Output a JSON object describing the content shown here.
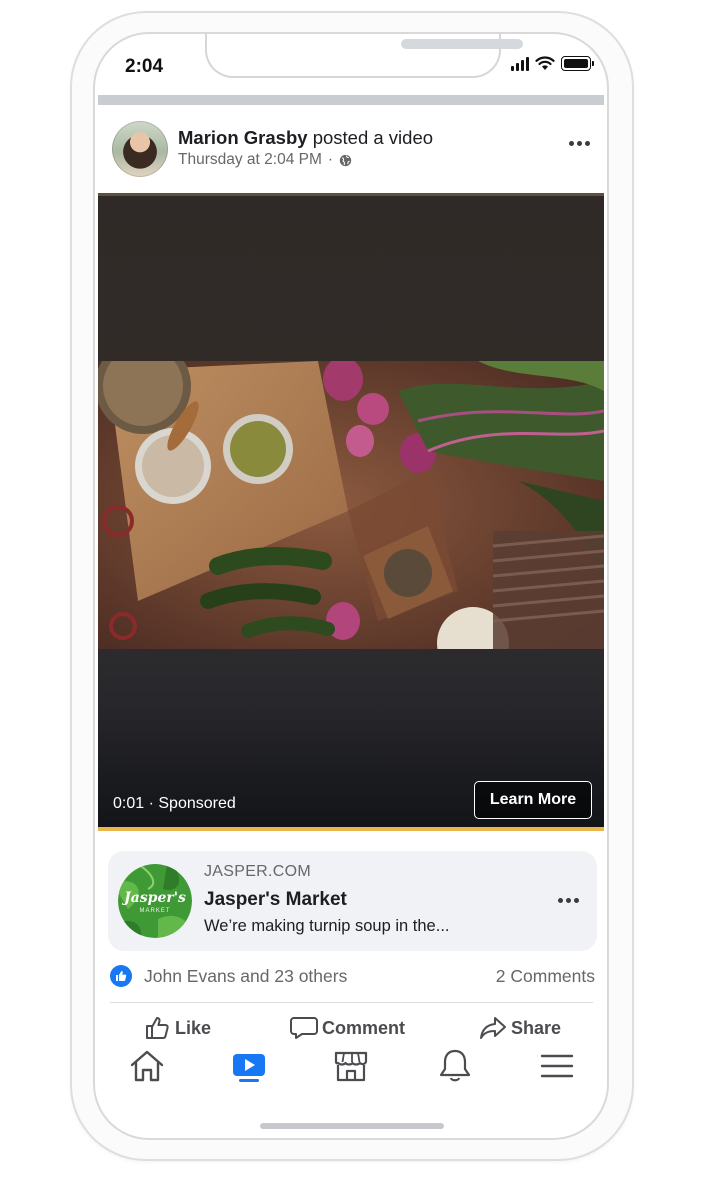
{
  "status_bar": {
    "time": "2:04"
  },
  "post": {
    "author": "Marion Grasby",
    "action_text": "posted a video",
    "timestamp": "Thursday at 2:04 PM",
    "separator": "·"
  },
  "video": {
    "elapsed": "0:01",
    "label": "· Sponsored",
    "cta_label": "Learn More"
  },
  "link_card": {
    "domain": "JASPER.COM",
    "title": "Jasper's Market",
    "description": "We’re making turnip soup in the...",
    "logo_text": "Jasper's",
    "logo_subtext": "MARKET"
  },
  "engagement": {
    "likes_text": "John Evans and 23 others",
    "comments_text": "2 Comments"
  },
  "actions": {
    "like_label": "Like",
    "comment_label": "Comment",
    "share_label": "Share"
  },
  "tabbar": {
    "tabs": [
      "home",
      "watch",
      "marketplace",
      "notifications",
      "menu"
    ],
    "active_tab": "watch"
  },
  "colors": {
    "facebook_blue": "#1877f2",
    "cta_accent": "#e8b64b",
    "brand_green": "#3f9a35"
  }
}
